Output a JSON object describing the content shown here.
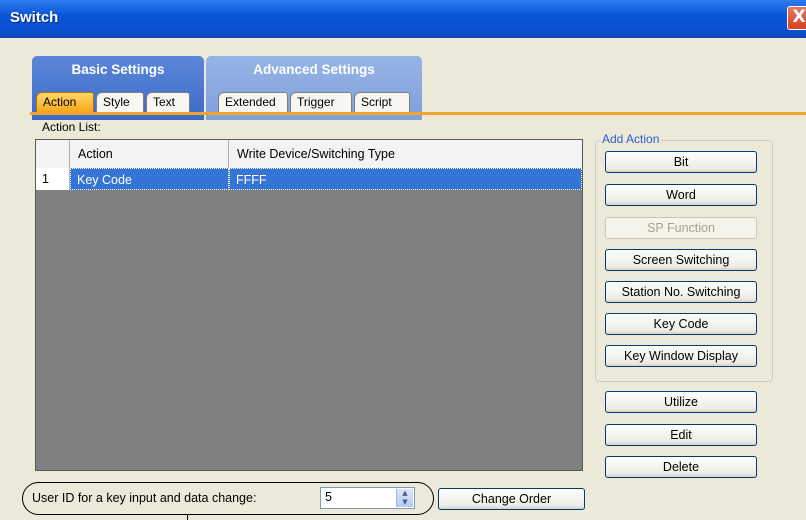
{
  "window": {
    "title": "Switch",
    "close_glyph": "X"
  },
  "groups": {
    "basic": {
      "label": "Basic Settings",
      "tabs": [
        "Action",
        "Style",
        "Text"
      ],
      "active_tab": "Action"
    },
    "advanced": {
      "label": "Advanced Settings",
      "tabs": [
        "Extended",
        "Trigger",
        "Script"
      ]
    }
  },
  "action_list": {
    "label": "Action List:",
    "columns": [
      "",
      "Action",
      "Write Device/Switching Type"
    ],
    "rows": [
      {
        "no": "1",
        "action": "Key Code",
        "target": "FFFF",
        "selected": true
      }
    ]
  },
  "add_action": {
    "legend": "Add Action",
    "buttons": {
      "bit": "Bit",
      "word": "Word",
      "sp_function": "SP Function",
      "screen_switching": "Screen Switching",
      "station_switching": "Station No. Switching",
      "key_code": "Key Code",
      "key_window_display": "Key Window Display"
    }
  },
  "side_buttons": {
    "utilize": "Utilize",
    "edit": "Edit",
    "delete": "Delete"
  },
  "bottom": {
    "user_id_label": "User ID for a key input and data change:",
    "user_id_value": "5",
    "change_order": "Change Order"
  },
  "colors": {
    "title_bar": "#0b4fcf",
    "active_tab": "#f7a718",
    "selection": "#3575d6",
    "legend": "#2a5ed4"
  }
}
